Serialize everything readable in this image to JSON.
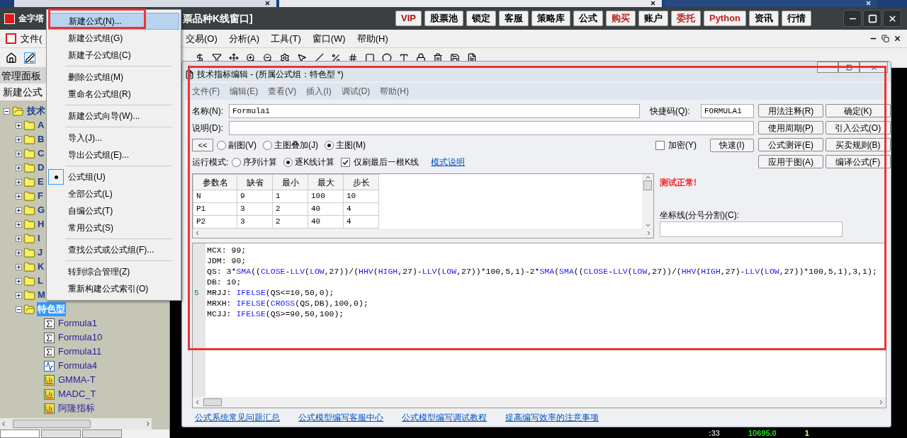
{
  "app": {
    "title_left": "金字塔",
    "title_right": "票品种K线窗口]",
    "toolbar_buttons": [
      {
        "label": "VIP",
        "color": "#b01010"
      },
      {
        "label": "股票池",
        "color": "#000000"
      },
      {
        "label": "锁定",
        "color": "#000000"
      },
      {
        "label": "客服",
        "color": "#000000"
      },
      {
        "label": "策略库",
        "color": "#000000"
      },
      {
        "label": "公式",
        "color": "#000000"
      },
      {
        "label": "购买",
        "color": "#c02020"
      },
      {
        "label": "账户",
        "color": "#000000"
      },
      {
        "label": "委托",
        "color": "#c02020"
      },
      {
        "label": "Python",
        "color": "#c02020"
      },
      {
        "label": "资讯",
        "color": "#000000"
      },
      {
        "label": "行情",
        "color": "#000000"
      }
    ]
  },
  "menu_bar": {
    "first": "文件(",
    "items": [
      "交易(O)",
      "分析(A)",
      "工具(T)",
      "窗口(W)",
      "帮助(H)"
    ]
  },
  "left_panel": {
    "header": "管理面板",
    "new_button": "新建公式",
    "tree": [
      {
        "label": "技术",
        "expanded": true,
        "selected": false,
        "children": [
          {
            "label": "A",
            "expanded": false,
            "selected": false
          },
          {
            "label": "B",
            "expanded": false,
            "selected": false
          },
          {
            "label": "C",
            "expanded": false,
            "selected": false
          },
          {
            "label": "D",
            "expanded": false,
            "selected": false
          },
          {
            "label": "E",
            "expanded": false,
            "selected": false
          },
          {
            "label": "F",
            "expanded": false,
            "selected": false
          },
          {
            "label": "G",
            "expanded": false,
            "selected": false
          },
          {
            "label": "H",
            "expanded": false,
            "selected": false
          },
          {
            "label": "I",
            "expanded": false,
            "selected": false
          },
          {
            "label": "J",
            "expanded": false,
            "selected": false
          },
          {
            "label": "K",
            "expanded": false,
            "selected": false
          },
          {
            "label": "L",
            "expanded": false,
            "selected": false
          },
          {
            "label": "M",
            "expanded": false,
            "selected": false
          },
          {
            "label": "特色型",
            "expanded": true,
            "selected": true,
            "children": [
              {
                "label": "Formula1",
                "kind": "formula",
                "selected": false
              },
              {
                "label": "Formula10",
                "kind": "formula",
                "selected": false
              },
              {
                "label": "Formula11",
                "kind": "formula",
                "selected": false
              },
              {
                "label": "Formula4",
                "kind": "line",
                "selected": false
              },
              {
                "label": "GMMA-T",
                "kind": "indicator",
                "selected": false
              },
              {
                "label": "MADC_T",
                "kind": "indicator",
                "selected": false
              },
              {
                "label": "阿隆指标",
                "kind": "indicator",
                "selected": false
              }
            ]
          }
        ]
      }
    ]
  },
  "context_menu": [
    {
      "kind": "item",
      "label": "新建公式(N)...",
      "highlighted": true
    },
    {
      "kind": "item",
      "label": "新建公式组(G)",
      "highlighted": false
    },
    {
      "kind": "item",
      "label": "新建子公式组(C)",
      "highlighted": false
    },
    {
      "kind": "separator"
    },
    {
      "kind": "item",
      "label": "删除公式组(M)",
      "highlighted": false
    },
    {
      "kind": "item",
      "label": "重命名公式组(R)",
      "highlighted": false
    },
    {
      "kind": "separator"
    },
    {
      "kind": "item",
      "label": "新建公式向导(W)...",
      "highlighted": false
    },
    {
      "kind": "separator"
    },
    {
      "kind": "item",
      "label": "导入(J)...",
      "highlighted": false
    },
    {
      "kind": "item",
      "label": "导出公式组(E)...",
      "highlighted": false
    },
    {
      "kind": "separator"
    },
    {
      "kind": "radio",
      "label": "公式组(U)",
      "selected": true
    },
    {
      "kind": "radio",
      "label": "全部公式(L)",
      "selected": false
    },
    {
      "kind": "radio",
      "label": "自编公式(T)",
      "selected": false
    },
    {
      "kind": "radio",
      "label": "常用公式(S)",
      "selected": false
    },
    {
      "kind": "separator"
    },
    {
      "kind": "item",
      "label": "查找公式或公式组(F)...",
      "highlighted": false
    },
    {
      "kind": "separator"
    },
    {
      "kind": "item",
      "label": "转到综合管理(Z)",
      "highlighted": false
    },
    {
      "kind": "item",
      "label": "重新构建公式索引(O)",
      "highlighted": false
    }
  ],
  "dialog": {
    "title": "技术指标编辑 - (所属公式组：特色型 *)",
    "menu": [
      "文件(F)",
      "编辑(E)",
      "查看(V)",
      "插入(I)",
      "调试(D)",
      "帮助(H)"
    ],
    "name_label": "名称(N):",
    "name_value": "Formula1",
    "shortcut_label": "快捷码(Q):",
    "shortcut_value": "FORMULA1",
    "desc_label": "说明(D):",
    "collapse_button": "<<",
    "chart_types": [
      {
        "label": "副图(V)",
        "selected": false
      },
      {
        "label": "主图叠加(J)",
        "selected": false
      },
      {
        "label": "主图(M)",
        "selected": true
      }
    ],
    "encrypt": {
      "label": "加密(Y)",
      "checked": false
    },
    "quick_button": "快速(I)",
    "run_mode_label": "运行模式:",
    "run_modes": [
      {
        "label": "序列计算",
        "selected": false
      },
      {
        "label": "逐K线计算",
        "selected": true
      }
    ],
    "last_bar_only": {
      "label": "仅刷最后一根K线",
      "checked": true
    },
    "mode_link": "模式说明",
    "side_buttons": [
      "用法注释(R)",
      "确定(K)",
      "使用周期(P)",
      "引入公式(O)",
      "公式测评(E)",
      "买卖规则(B)",
      "应用于图(A)",
      "编译公式(F)"
    ],
    "params": {
      "columns": [
        "参数名",
        "缺省",
        "最小",
        "最大",
        "步长"
      ],
      "rows": [
        [
          "N",
          "9",
          "1",
          "100",
          "10"
        ],
        [
          "P1",
          "3",
          "2",
          "40",
          "4"
        ],
        [
          "P2",
          "3",
          "2",
          "40",
          "4"
        ]
      ]
    },
    "test_status": "测试正常!",
    "axis_label": "坐标线(分号分割)(C):",
    "code": [
      {
        "segments": [
          {
            "text": "MCX: 99;",
            "kind": "plain"
          }
        ]
      },
      {
        "segments": [
          {
            "text": "JDM: 90;",
            "kind": "plain"
          }
        ]
      },
      {
        "segments": [
          {
            "text": "QS: 3*",
            "kind": "plain"
          },
          {
            "text": "SMA",
            "kind": "func"
          },
          {
            "text": "((",
            "kind": "plain"
          },
          {
            "text": "CLOSE",
            "kind": "func"
          },
          {
            "text": "-",
            "kind": "plain"
          },
          {
            "text": "LLV",
            "kind": "func"
          },
          {
            "text": "(",
            "kind": "plain"
          },
          {
            "text": "LOW",
            "kind": "func"
          },
          {
            "text": ",27))/(",
            "kind": "plain"
          },
          {
            "text": "HHV",
            "kind": "func"
          },
          {
            "text": "(",
            "kind": "plain"
          },
          {
            "text": "HIGH",
            "kind": "func"
          },
          {
            "text": ",27)-",
            "kind": "plain"
          },
          {
            "text": "LLV",
            "kind": "func"
          },
          {
            "text": "(",
            "kind": "plain"
          },
          {
            "text": "LOW",
            "kind": "func"
          },
          {
            "text": ",27))*100,5,1)-2*",
            "kind": "plain"
          },
          {
            "text": "SMA",
            "kind": "func"
          },
          {
            "text": "(",
            "kind": "plain"
          },
          {
            "text": "SMA",
            "kind": "func"
          },
          {
            "text": "((",
            "kind": "plain"
          },
          {
            "text": "CLOSE",
            "kind": "func"
          },
          {
            "text": "-",
            "kind": "plain"
          },
          {
            "text": "LLV",
            "kind": "func"
          },
          {
            "text": "(",
            "kind": "plain"
          },
          {
            "text": "LOW",
            "kind": "func"
          },
          {
            "text": ",27))/(",
            "kind": "plain"
          },
          {
            "text": "HHV",
            "kind": "func"
          },
          {
            "text": "(",
            "kind": "plain"
          },
          {
            "text": "HIGH",
            "kind": "func"
          },
          {
            "text": ",27)-",
            "kind": "plain"
          },
          {
            "text": "LLV",
            "kind": "func"
          },
          {
            "text": "(",
            "kind": "plain"
          },
          {
            "text": "LOW",
            "kind": "func"
          },
          {
            "text": ",27))*100,5,1),3,1);",
            "kind": "plain"
          }
        ]
      },
      {
        "segments": [
          {
            "text": "DB: 10;",
            "kind": "plain"
          }
        ]
      },
      {
        "number": "5",
        "segments": [
          {
            "text": "MRJJ: ",
            "kind": "plain"
          },
          {
            "text": "IFELSE",
            "kind": "func"
          },
          {
            "text": "(QS<=10,50,0);",
            "kind": "plain"
          }
        ]
      },
      {
        "segments": [
          {
            "text": "MRXH: ",
            "kind": "plain"
          },
          {
            "text": "IFELSE",
            "kind": "func"
          },
          {
            "text": "(",
            "kind": "plain"
          },
          {
            "text": "CROSS",
            "kind": "func"
          },
          {
            "text": "(QS,DB),100,0);",
            "kind": "plain"
          }
        ]
      },
      {
        "segments": [
          {
            "text": "MCJJ: ",
            "kind": "plain"
          },
          {
            "text": "IFELSE",
            "kind": "func"
          },
          {
            "text": "(QS>=90,50,100);",
            "kind": "plain"
          }
        ]
      }
    ],
    "links": [
      "公式系统常见问题汇总",
      "公式模型编写客服中心",
      "公式模型编写调试教程",
      "提高编写效率的注意事项"
    ]
  },
  "chart_status": [
    ":33",
    "10695.0",
    "1"
  ],
  "panel_tabs": [
    {
      "selected": true
    },
    {
      "selected": false
    },
    {
      "selected": false
    }
  ]
}
